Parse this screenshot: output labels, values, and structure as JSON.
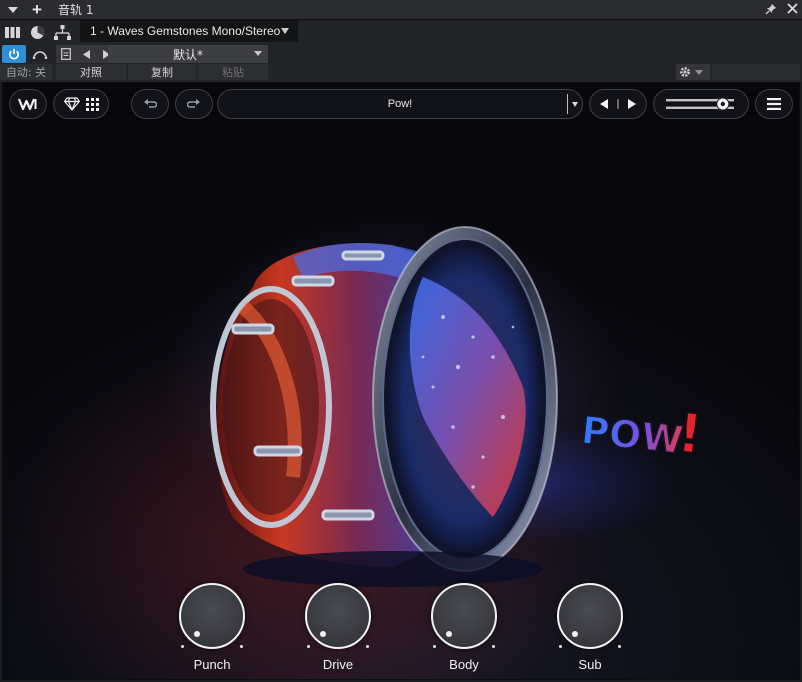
{
  "window": {
    "title": "音轨 1",
    "add_label": "+",
    "pin_label": "📌",
    "close_label": "✕"
  },
  "host": {
    "track_select": "1 - Waves Gemstones Mono/Stereo",
    "preset_name": "默认*",
    "auto_label": "自动: 关",
    "compare_label": "对照",
    "copy_label": "复制",
    "paste_label": "粘贴",
    "power_color": "#2f8fd6"
  },
  "plugin": {
    "preset_name": "Pow!",
    "output_level": 0.82,
    "icons": [
      "waves-logo-icon",
      "diamond-icon",
      "grid-icon",
      "undo-icon",
      "redo-icon",
      "prev-icon",
      "next-icon",
      "hamburger-icon"
    ],
    "knobs": [
      {
        "label": "Punch"
      },
      {
        "label": "Drive"
      },
      {
        "label": "Body"
      },
      {
        "label": "Sub"
      }
    ],
    "artwork_text": "POW !",
    "accent_colors": {
      "blue": "#2d6bff",
      "red": "#e0252f"
    }
  }
}
